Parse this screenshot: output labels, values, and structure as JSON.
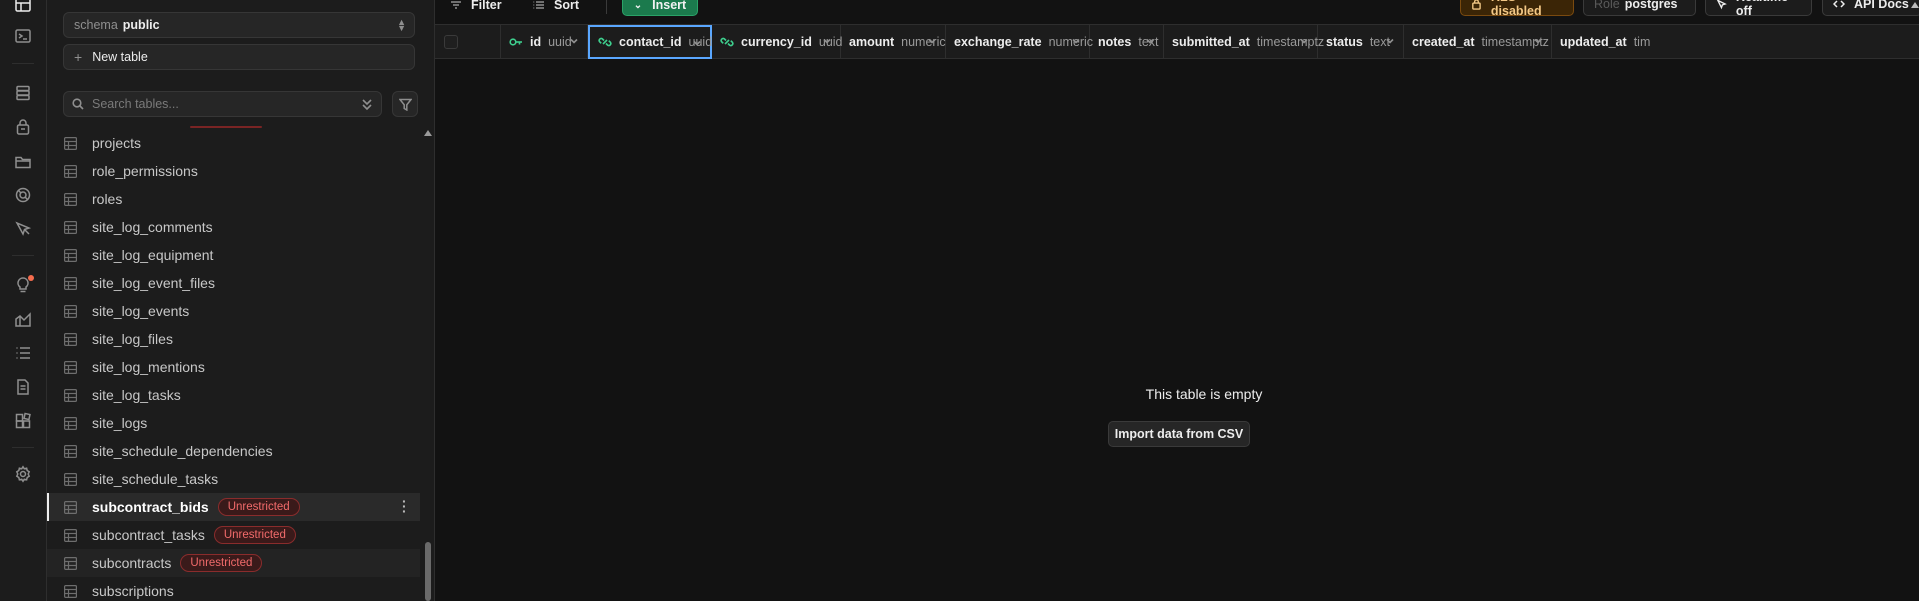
{
  "rail": {
    "icons": [
      "table-editor-icon",
      "sql-editor-icon",
      "database-icon",
      "auth-icon",
      "storage-icon",
      "realtime-icon",
      "edge-functions-icon",
      "advisors-icon",
      "reports-icon",
      "logs-icon",
      "api-docs-icon",
      "integrations-icon",
      "settings-icon"
    ]
  },
  "sidebar": {
    "schema_label": "schema",
    "schema_value": "public",
    "new_table_label": "New table",
    "search_placeholder": "Search tables...",
    "tables": [
      {
        "name": "projects"
      },
      {
        "name": "role_permissions"
      },
      {
        "name": "roles"
      },
      {
        "name": "site_log_comments"
      },
      {
        "name": "site_log_equipment"
      },
      {
        "name": "site_log_event_files"
      },
      {
        "name": "site_log_events"
      },
      {
        "name": "site_log_files"
      },
      {
        "name": "site_log_mentions"
      },
      {
        "name": "site_log_tasks"
      },
      {
        "name": "site_logs"
      },
      {
        "name": "site_schedule_dependencies"
      },
      {
        "name": "site_schedule_tasks"
      },
      {
        "name": "subcontract_bids",
        "badge": "Unrestricted",
        "selected": true
      },
      {
        "name": "subcontract_tasks",
        "badge": "Unrestricted"
      },
      {
        "name": "subcontracts",
        "badge": "Unrestricted"
      },
      {
        "name": "subscriptions"
      }
    ]
  },
  "toolbar": {
    "filter_label": "Filter",
    "sort_label": "Sort",
    "insert_label": "Insert",
    "rls_label": "RLS disabled",
    "role_label": "Role",
    "role_value": "postgres",
    "realtime_label": "Realtime off",
    "api_docs_label": "API Docs"
  },
  "columns": [
    {
      "name": "id",
      "type": "uuid",
      "icon": "key-icon"
    },
    {
      "name": "contact_id",
      "type": "uuid",
      "icon": "link-icon"
    },
    {
      "name": "currency_id",
      "type": "uuid",
      "icon": "link-icon"
    },
    {
      "name": "amount",
      "type": "numeric"
    },
    {
      "name": "exchange_rate",
      "type": "numeric"
    },
    {
      "name": "notes",
      "type": "text"
    },
    {
      "name": "submitted_at",
      "type": "timestamptz"
    },
    {
      "name": "status",
      "type": "text"
    },
    {
      "name": "created_at",
      "type": "timestamptz"
    },
    {
      "name": "updated_at",
      "type": "tim"
    }
  ],
  "empty_state": {
    "message": "This table is empty",
    "import_label": "Import data from CSV"
  },
  "colors": {
    "accent_green": "#3ecf8e",
    "unrestricted_red": "#f26b6b",
    "rls_amber": "#f3c886",
    "selection_blue": "#5aa7ff"
  }
}
